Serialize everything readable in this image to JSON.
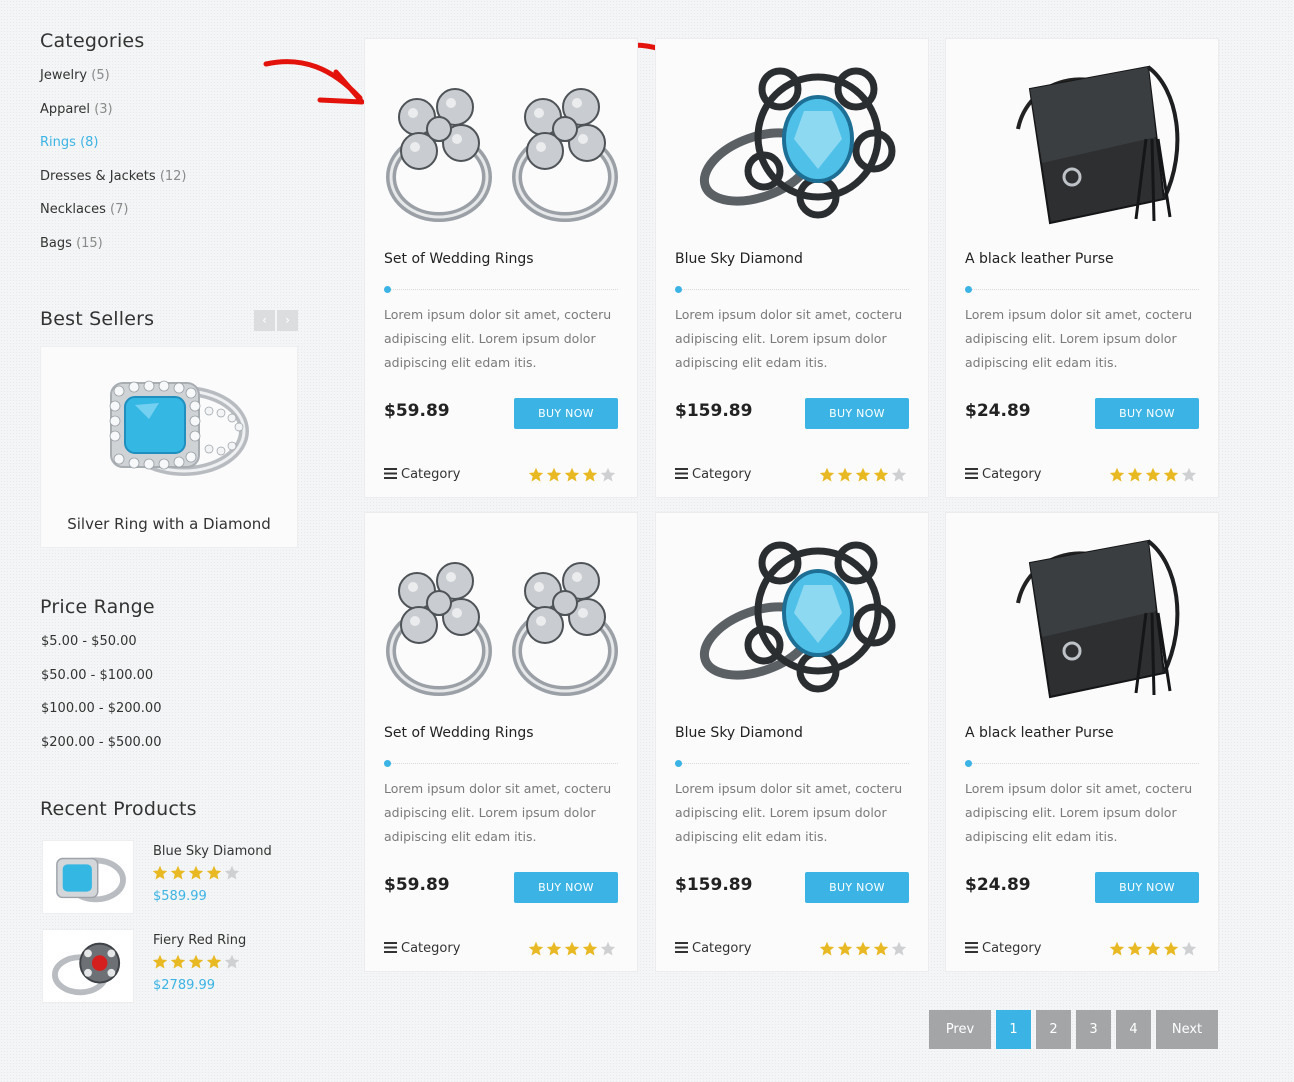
{
  "sidebar": {
    "categories": {
      "title": "Categories",
      "items": [
        {
          "label": "Jewelry",
          "count": "(5)"
        },
        {
          "label": "Apparel",
          "count": "(3)"
        },
        {
          "label": "Rings",
          "count": "(8)"
        },
        {
          "label": "Dresses & Jackets",
          "count": "(12)"
        },
        {
          "label": "Necklaces",
          "count": "(7)"
        },
        {
          "label": "Bags",
          "count": "(15)"
        }
      ]
    },
    "best_sellers": {
      "title": "Best Sellers",
      "prev_icon": "chevron-left-icon",
      "next_icon": "chevron-right-icon",
      "prev_glyph": "‹",
      "next_glyph": "›",
      "product_name": "Silver Ring with a Diamond"
    },
    "price_range": {
      "title": "Price Range",
      "items": [
        "$5.00 - $50.00",
        "$50.00 - $100.00",
        "$100.00 - $200.00",
        "$200.00 - $500.00"
      ]
    },
    "recent_products": {
      "title": "Recent Products",
      "items": [
        {
          "name": "Blue Sky Diamond",
          "price": "$589.99",
          "rating": 4
        },
        {
          "name": "Fiery Red Ring",
          "price": "$2789.99",
          "rating": 4
        }
      ]
    }
  },
  "products": [
    {
      "title": "Set of Wedding Rings",
      "desc": "Lorem ipsum dolor sit amet, cocteru adipiscing elit. Lorem ipsum dolor adipiscing elit edam itis.",
      "price": "$59.89",
      "buy_label": "BUY NOW",
      "category": "Category",
      "rating": 4
    },
    {
      "title": "Blue Sky Diamond",
      "desc": "Lorem ipsum dolor sit amet, cocteru adipiscing elit. Lorem ipsum dolor adipiscing elit edam itis.",
      "price": "$159.89",
      "buy_label": "BUY NOW",
      "category": "Category",
      "rating": 4
    },
    {
      "title": "A black leather Purse",
      "desc": "Lorem ipsum dolor sit amet, cocteru adipiscing elit. Lorem ipsum dolor adipiscing elit edam itis.",
      "price": "$24.89",
      "buy_label": "BUY NOW",
      "category": "Category",
      "rating": 4
    },
    {
      "title": "Set of Wedding Rings",
      "desc": "Lorem ipsum dolor sit amet, cocteru adipiscing elit. Lorem ipsum dolor adipiscing elit edam itis.",
      "price": "$59.89",
      "buy_label": "BUY NOW",
      "category": "Category",
      "rating": 4
    },
    {
      "title": "Blue Sky Diamond",
      "desc": "Lorem ipsum dolor sit amet, cocteru adipiscing elit. Lorem ipsum dolor adipiscing elit edam itis.",
      "price": "$159.89",
      "buy_label": "BUY NOW",
      "category": "Category",
      "rating": 4
    },
    {
      "title": "A black leather Purse",
      "desc": "Lorem ipsum dolor sit amet, cocteru adipiscing elit. Lorem ipsum dolor adipiscing elit edam itis.",
      "price": "$24.89",
      "buy_label": "BUY NOW",
      "category": "Category",
      "rating": 4
    }
  ],
  "pagination": {
    "prev": "Prev",
    "pages": [
      "1",
      "2",
      "3",
      "4"
    ],
    "next": "Next",
    "current": "1"
  },
  "colors": {
    "accent": "#3bb4e5",
    "star_on": "#e8b923",
    "star_off": "#cfd0d2",
    "annotation_arrow": "#e3120b"
  }
}
